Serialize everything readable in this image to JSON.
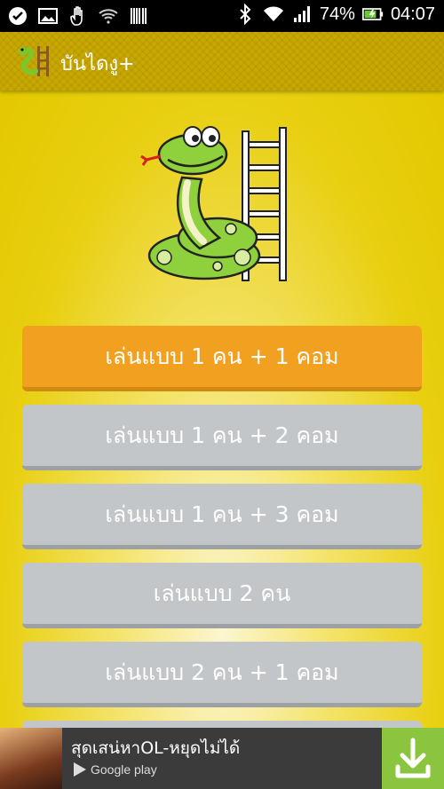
{
  "status_bar": {
    "battery_percent": "74%",
    "time": "04:07",
    "icons": [
      "check-circle-icon",
      "image-icon",
      "hand-icon",
      "wifi-icon",
      "barcode-icon",
      "bluetooth-icon",
      "wifi-signal-icon",
      "cell-signal-icon",
      "battery-charging-icon"
    ]
  },
  "action_bar": {
    "title": "บันไดงู+",
    "icon": "snake-ladder-app-icon"
  },
  "menu": {
    "buttons": [
      {
        "label": "เล่นแบบ 1 คน + 1 คอม",
        "selected": true
      },
      {
        "label": "เล่นแบบ 1 คน + 2 คอม",
        "selected": false
      },
      {
        "label": "เล่นแบบ 1 คน + 3 คอม",
        "selected": false
      },
      {
        "label": "เล่นแบบ 2 คน",
        "selected": false
      },
      {
        "label": "เล่นแบบ 2 คน + 1 คอม",
        "selected": false
      }
    ]
  },
  "ad": {
    "title": "สุดเสน่หาOL-หยุดไม่ได้",
    "store": "Google play",
    "action_icon": "download-icon"
  },
  "colors": {
    "primary_button": "#f1a020",
    "secondary_button": "#c3c6c9",
    "background": "#e8cf10",
    "action_bar": "#c8a800",
    "download": "#8bc53f"
  }
}
